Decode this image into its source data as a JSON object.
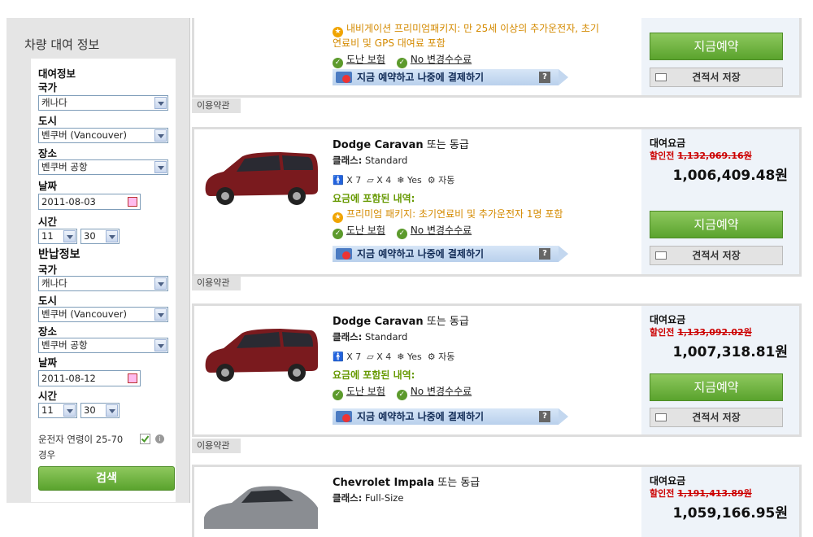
{
  "sidebar": {
    "title": "차량 대여 정보",
    "pickup_heading": "대여정보",
    "country_label": "국가",
    "country_value": "캐나다",
    "city_label": "도시",
    "city_value": "벤쿠버 (Vancouver)",
    "location_label": "장소",
    "location_value": "벤쿠버 공항",
    "date_label": "날짜",
    "pickup_date": "2011-08-03",
    "time_label": "시간",
    "pickup_hour": "11",
    "pickup_minute": "30",
    "return_heading": "반납정보",
    "return_country": "캐나다",
    "return_city": "벤쿠버 (Vancouver)",
    "return_location": "벤쿠버 공항",
    "return_date": "2011-08-12",
    "return_hour": "11",
    "return_minute": "30",
    "age_text": "운전자 연령이 25-70 경우",
    "search_label": "검색"
  },
  "common": {
    "theft_label": "도난 보험",
    "no_change_fee": "No 변경수수료",
    "pay_later": "지금 예약하고 나중에 결제하기",
    "help": "?",
    "terms": "이용약관",
    "rent_label": "대여요금",
    "discount_prefix": "할인전",
    "book_label": "지금예약",
    "quote_label": "견적서 저장",
    "included_title": "요금에 포함된 내역:",
    "or_similar": "또는 동급",
    "class_prefix": "클래스:"
  },
  "top_card": {
    "premium_text_1": "내비게이션 프리미엄패키지: 만 25세 이상의 추가운전자, 초기",
    "premium_text_2": "연료비 및 GPS 대여료 포함"
  },
  "cars": [
    {
      "model": "Dodge Caravan",
      "class": "Standard",
      "seats": "X 7",
      "bags": "X 4",
      "ac": "Yes",
      "trans": "자동",
      "premium": "프리미엄 패키지: 초기연료비 및 추가운전자 1명 포함",
      "old_price": "1,132,069.16원",
      "price": "1,006,409.48원"
    },
    {
      "model": "Dodge Caravan",
      "class": "Standard",
      "seats": "X 7",
      "bags": "X 4",
      "ac": "Yes",
      "trans": "자동",
      "old_price": "1,133,092.02원",
      "price": "1,007,318.81원"
    },
    {
      "model": "Chevrolet Impala",
      "class": "Full-Size",
      "old_price": "1,191,413.89원",
      "price": "1,059,166.95원"
    }
  ],
  "colors": {
    "accent_green": "#5aa32d",
    "discount_red": "#cc0000",
    "premium_orange": "#d48a00"
  }
}
